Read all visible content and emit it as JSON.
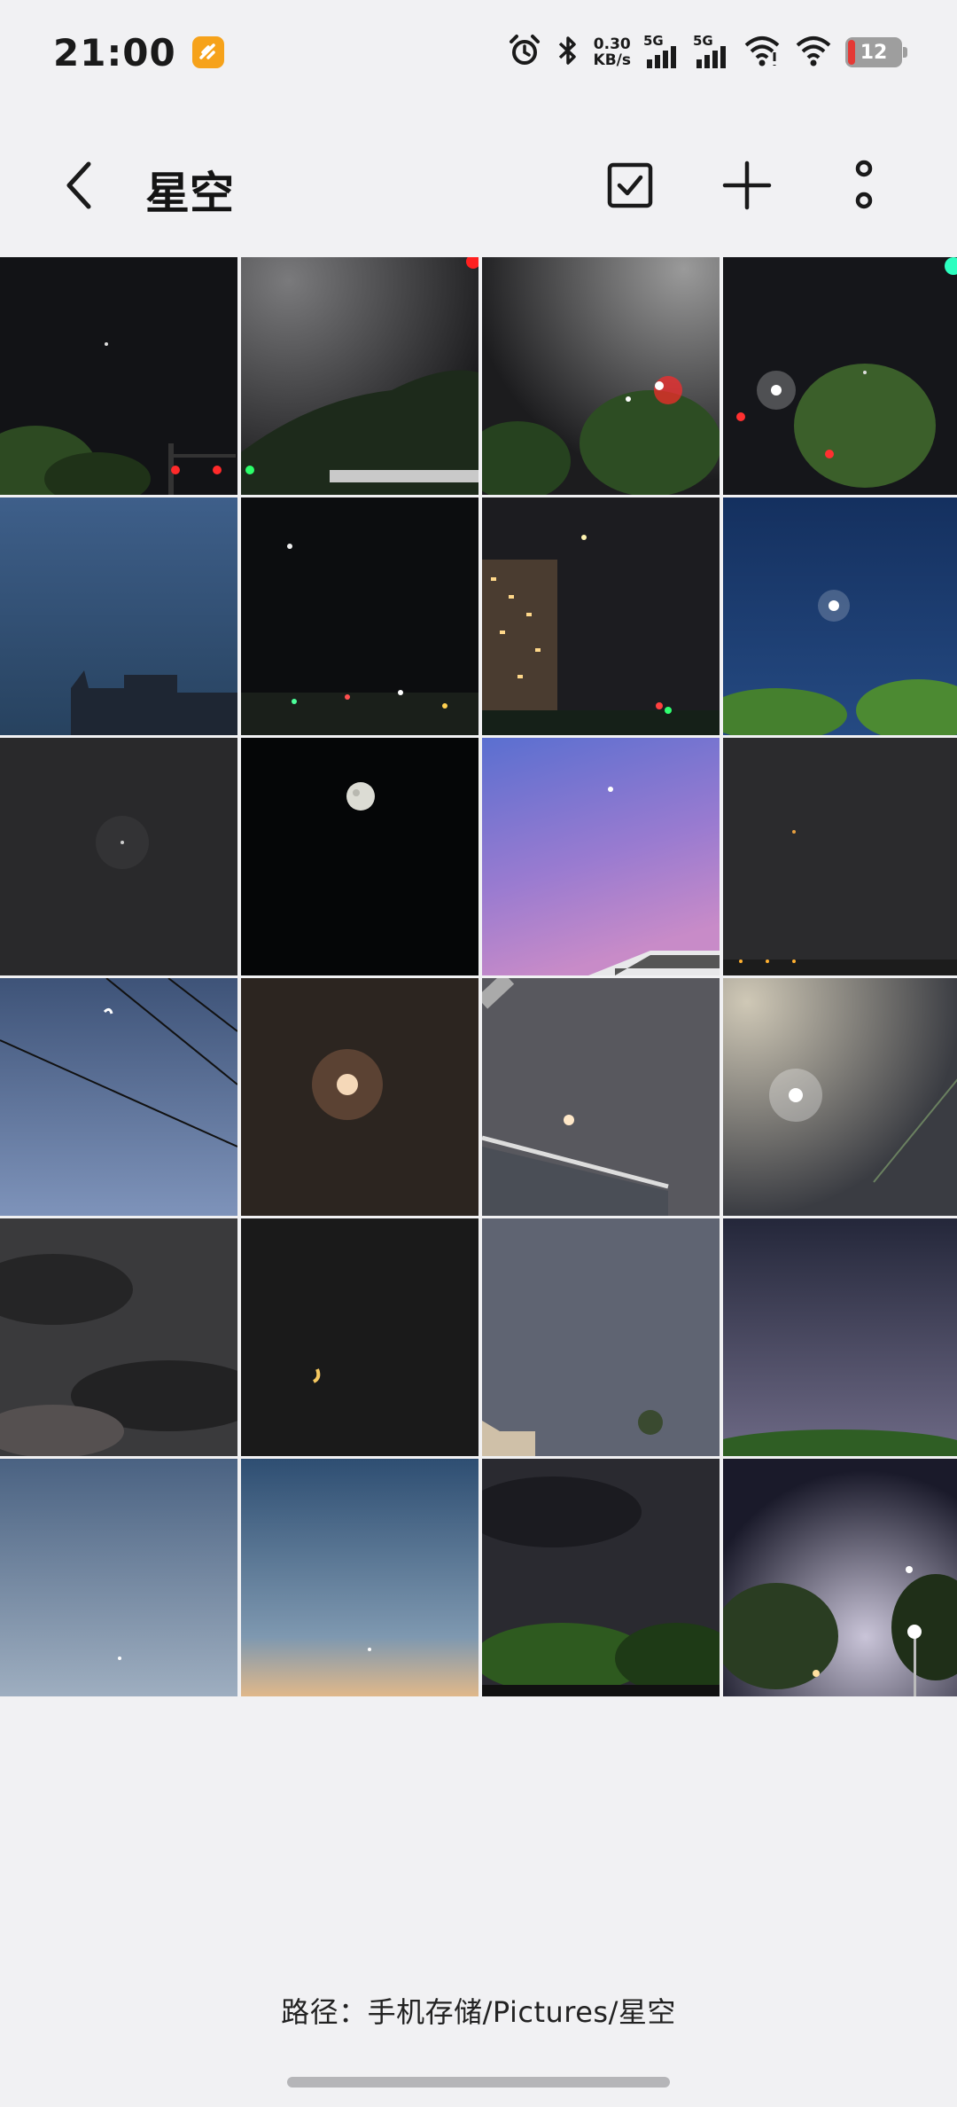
{
  "status_bar": {
    "time": "21:00",
    "speed_value": "0.30",
    "speed_unit": "KB/s",
    "net1_label": "5G",
    "net2_label": "5G",
    "battery_level": "12"
  },
  "toolbar": {
    "title": "星空",
    "icons": [
      "back-arrow-icon",
      "select-checkbox-icon",
      "add-icon",
      "more-options-icon"
    ]
  },
  "photos": [
    {
      "desc": "night sky with trees and red traffic lights"
    },
    {
      "desc": "night street with green traffic light and railing"
    },
    {
      "desc": "night street lamps with red light and trees"
    },
    {
      "desc": "street lamp with traffic lights and trees"
    },
    {
      "desc": "blue dusk sky with building silhouette"
    },
    {
      "desc": "dark night sky with moon and street lights"
    },
    {
      "desc": "night sky with lit apartment building"
    },
    {
      "desc": "deep blue sky with bright moon over trees"
    },
    {
      "desc": "dark grey sky with faint star"
    },
    {
      "desc": "full moon on black sky"
    },
    {
      "desc": "purple and pink evening sky with building"
    },
    {
      "desc": "dark grey sky with distant lights"
    },
    {
      "desc": "blue sky with crescent moon and power lines"
    },
    {
      "desc": "hazy brown sky with glowing moon"
    },
    {
      "desc": "grey sky with moon and canopy roof"
    },
    {
      "desc": "bright moon with lens flare"
    },
    {
      "desc": "cloudy night sky"
    },
    {
      "desc": "dark sky with crescent moon"
    },
    {
      "desc": "noisy grey-blue night sky with rooftop"
    },
    {
      "desc": "dark blue sky with green hedge"
    },
    {
      "desc": "blue twilight sky gradient"
    },
    {
      "desc": "twilight sky with orange horizon"
    },
    {
      "desc": "dark sky with lit green trees"
    },
    {
      "desc": "night sky with street lamp and trees"
    }
  ],
  "footer": {
    "path": "路径：手机存储/Pictures/星空"
  }
}
